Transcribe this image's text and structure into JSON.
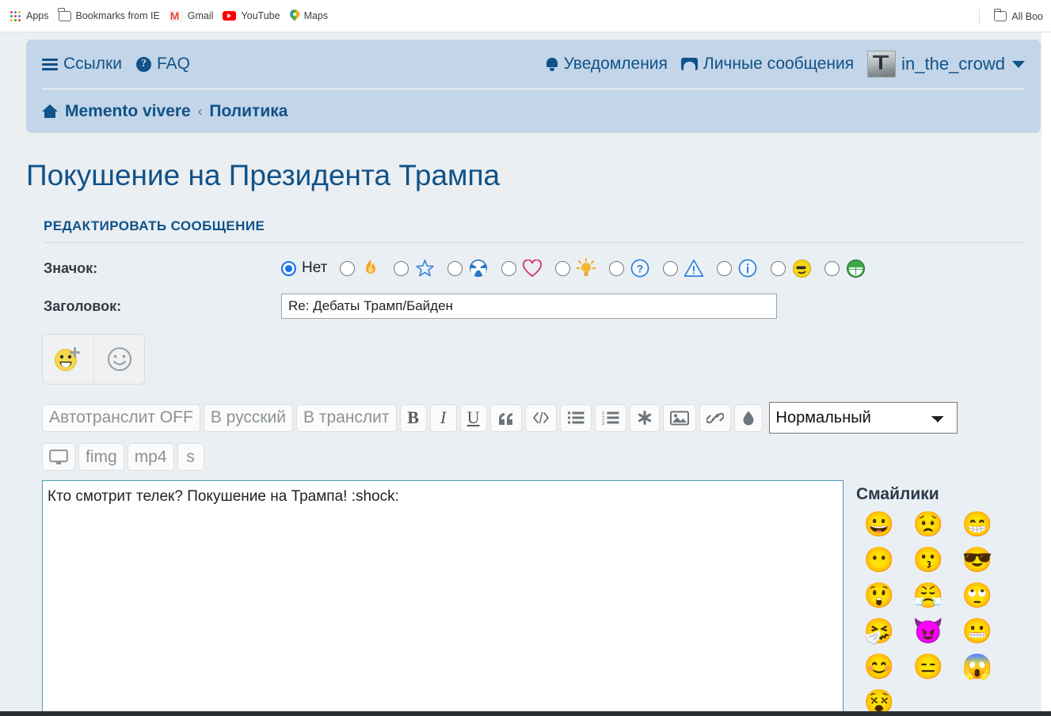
{
  "browser": {
    "bookmarks": [
      {
        "label": "Apps",
        "icon": "apps-grid-icon"
      },
      {
        "label": "Bookmarks from IE",
        "icon": "folder-icon"
      },
      {
        "label": "Gmail",
        "icon": "gmail-icon"
      },
      {
        "label": "YouTube",
        "icon": "youtube-icon"
      },
      {
        "label": "Maps",
        "icon": "maps-icon"
      }
    ],
    "all_bookmarks_label": "All Boo"
  },
  "header": {
    "links_label": "Ссылки",
    "faq_label": "FAQ",
    "notifications_label": "Уведомления",
    "messages_label": "Личные сообщения",
    "username": "in_the_crowd",
    "breadcrumb": {
      "home": "Memento vivere",
      "separator": "‹",
      "current": "Политика"
    },
    "background": "#c3d5e8",
    "link_color": "#105289"
  },
  "topic": {
    "title": "Покушение на Президента Трампа"
  },
  "panel": {
    "title": "РЕДАКТИРОВАТЬ СООБЩЕНИЕ",
    "icon_row": {
      "label": "Значок:",
      "none_label": "Нет",
      "selected_index": 0,
      "options": [
        {
          "name": "none",
          "glyph": ""
        },
        {
          "name": "fire-icon",
          "glyph": "🔥"
        },
        {
          "name": "star-icon",
          "glyph": "☆"
        },
        {
          "name": "radioactive-icon",
          "glyph": "☢"
        },
        {
          "name": "heart-icon",
          "glyph": "♡"
        },
        {
          "name": "lightbulb-icon",
          "glyph": "💡"
        },
        {
          "name": "question-icon",
          "glyph": "?"
        },
        {
          "name": "warning-icon",
          "glyph": "⚠"
        },
        {
          "name": "info-icon",
          "glyph": "i"
        },
        {
          "name": "smirk-smiley-icon",
          "glyph": "😏"
        },
        {
          "name": "green-grin-icon",
          "glyph": "😁"
        }
      ]
    },
    "subject_row": {
      "label": "Заголовок:",
      "value": "Re: Дебаты Трамп/Байден",
      "placeholder": ""
    },
    "smiley_buttons": [
      {
        "name": "add-smiley-button",
        "glyph": "😀"
      },
      {
        "name": "smiley-picker-button",
        "glyph": "☺"
      }
    ],
    "toolbar": {
      "row1": [
        {
          "name": "autotranslit-button",
          "label": "Автотранслит OFF",
          "type": "text"
        },
        {
          "name": "to-russian-button",
          "label": "В русский",
          "type": "text"
        },
        {
          "name": "to-translit-button",
          "label": "В транслит",
          "type": "text"
        },
        {
          "name": "bold-button",
          "label": "B",
          "type": "bold"
        },
        {
          "name": "italic-button",
          "label": "I",
          "type": "ital"
        },
        {
          "name": "underline-button",
          "label": "U",
          "type": "under"
        },
        {
          "name": "quote-button",
          "label": "❝",
          "type": "glyph"
        },
        {
          "name": "code-button",
          "label": "</>",
          "type": "code"
        },
        {
          "name": "bullet-list-button",
          "label": "",
          "type": "ul"
        },
        {
          "name": "numbered-list-button",
          "label": "",
          "type": "ol"
        },
        {
          "name": "asterisk-button",
          "label": "✱",
          "type": "glyph"
        },
        {
          "name": "image-button",
          "label": "",
          "type": "img"
        },
        {
          "name": "link-button",
          "label": "",
          "type": "link"
        },
        {
          "name": "color-droplet-button",
          "label": "",
          "type": "drop"
        }
      ],
      "font_size_selected": "Нормальный",
      "font_size_options": [
        "Нормальный"
      ],
      "row2": [
        {
          "name": "screen-button",
          "label": "",
          "type": "monitor"
        },
        {
          "name": "fimg-button",
          "label": "fimg",
          "type": "text"
        },
        {
          "name": "mp4-button",
          "label": "mp4",
          "type": "text"
        },
        {
          "name": "s-button",
          "label": "s",
          "type": "text"
        }
      ]
    },
    "message": {
      "value": "Кто смотрит телек? Покушение на Трампа! :shock:",
      "placeholder": "",
      "border_color": "#4b9bb8"
    },
    "smilies": {
      "title": "Смайлики",
      "items": [
        "😀",
        "😟",
        "😁",
        "😶",
        "😗",
        "😎",
        "😲",
        "😤",
        "🙄",
        "🤧",
        "😈",
        "😬",
        "😊",
        "😑",
        "😱",
        "😵"
      ]
    }
  }
}
